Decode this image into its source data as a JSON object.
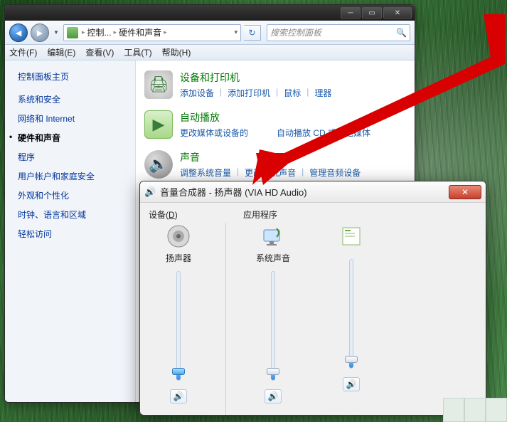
{
  "cp": {
    "breadcrumb": {
      "root": "控制...",
      "leaf": "硬件和声音"
    },
    "search_placeholder": "搜索控制面板",
    "menu": {
      "file": "文件(F)",
      "edit": "编辑(E)",
      "view": "查看(V)",
      "tools": "工具(T)",
      "help": "帮助(H)"
    },
    "side": {
      "home": "控制面板主页",
      "items": [
        "系统和安全",
        "网络和 Internet",
        "硬件和声音",
        "程序",
        "用户帐户和家庭安全",
        "外观和个性化",
        "时钟、语言和区域",
        "轻松访问"
      ],
      "active_index": 2
    },
    "cats": [
      {
        "title": "设备和打印机",
        "links": [
          "添加设备",
          "添加打印机",
          "鼠标",
          "理器"
        ]
      },
      {
        "title": "自动播放",
        "links_raw": "更改媒体或设备的",
        "links_tail": "自动播放 CD 或其他媒体"
      },
      {
        "title": "声音",
        "links": [
          "调整系统音量",
          "更改系统声音",
          "管理音频设备"
        ]
      }
    ]
  },
  "mixer": {
    "title": "音量合成器 - 扬声器 (VIA HD Audio)",
    "device_label": "设备",
    "device_ak": "D",
    "app_label": "应用程序",
    "channels": [
      {
        "name": "扬声器",
        "level": 8,
        "active": true
      },
      {
        "name": "系统声音",
        "level": 8,
        "active": false
      },
      {
        "name": "",
        "level": 8,
        "active": false
      }
    ]
  }
}
